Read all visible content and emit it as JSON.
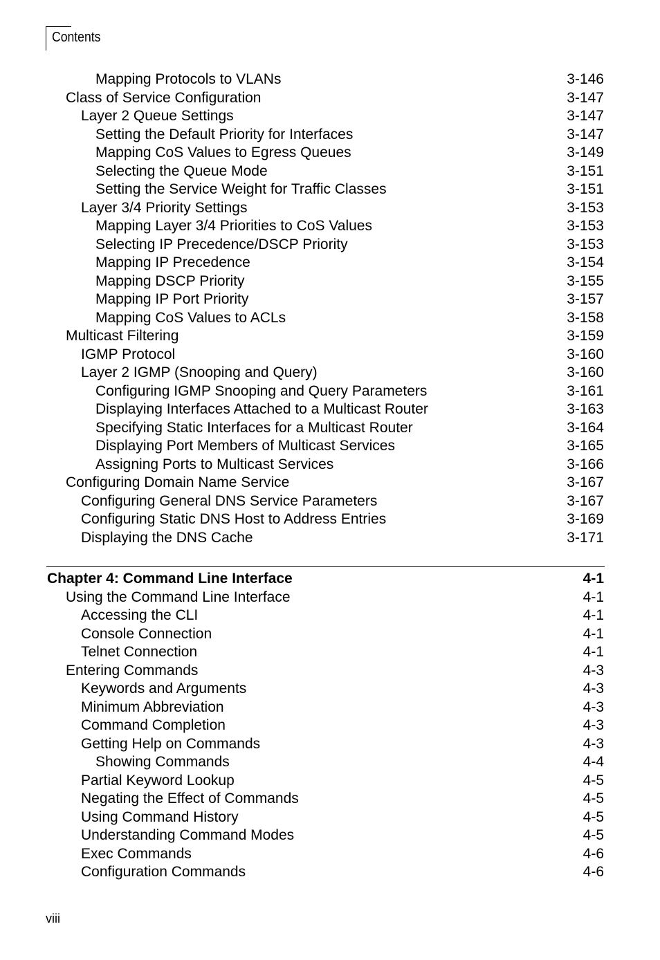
{
  "header": {
    "title": "Contents"
  },
  "footer": {
    "page_number": "viii"
  },
  "entries": [
    {
      "level": 3,
      "title": "Mapping Protocols to VLANs",
      "page": "3-146"
    },
    {
      "level": 1,
      "title": "Class of Service Configuration",
      "page": "3-147"
    },
    {
      "level": 2,
      "title": "Layer 2 Queue Settings",
      "page": "3-147"
    },
    {
      "level": 3,
      "title": "Setting the Default Priority for Interfaces",
      "page": "3-147"
    },
    {
      "level": 3,
      "title": "Mapping CoS Values to Egress Queues",
      "page": "3-149"
    },
    {
      "level": 3,
      "title": "Selecting the Queue Mode",
      "page": "3-151"
    },
    {
      "level": 3,
      "title": "Setting the Service Weight for Traffic Classes",
      "page": "3-151"
    },
    {
      "level": 2,
      "title": "Layer 3/4 Priority Settings",
      "page": "3-153"
    },
    {
      "level": 3,
      "title": "Mapping Layer 3/4 Priorities to CoS Values",
      "page": "3-153"
    },
    {
      "level": 3,
      "title": "Selecting IP Precedence/DSCP Priority",
      "page": "3-153"
    },
    {
      "level": 3,
      "title": "Mapping IP Precedence",
      "page": "3-154"
    },
    {
      "level": 3,
      "title": "Mapping DSCP Priority",
      "page": "3-155"
    },
    {
      "level": 3,
      "title": "Mapping IP Port Priority",
      "page": "3-157"
    },
    {
      "level": 3,
      "title": "Mapping CoS Values to ACLs",
      "page": "3-158"
    },
    {
      "level": 1,
      "title": "Multicast Filtering",
      "page": "3-159"
    },
    {
      "level": 2,
      "title": "IGMP Protocol",
      "page": "3-160"
    },
    {
      "level": 2,
      "title": "Layer 2 IGMP (Snooping and Query)",
      "page": "3-160"
    },
    {
      "level": 3,
      "title": "Configuring IGMP Snooping and Query Parameters",
      "page": "3-161"
    },
    {
      "level": 3,
      "title": "Displaying Interfaces Attached to a Multicast Router",
      "page": "3-163"
    },
    {
      "level": 3,
      "title": "Specifying Static Interfaces for a Multicast Router",
      "page": "3-164"
    },
    {
      "level": 3,
      "title": "Displaying Port Members of Multicast Services",
      "page": "3-165"
    },
    {
      "level": 3,
      "title": "Assigning Ports to Multicast Services",
      "page": "3-166"
    },
    {
      "level": 1,
      "title": "Configuring Domain Name Service",
      "page": "3-167"
    },
    {
      "level": 2,
      "title": "Configuring General DNS Service Parameters",
      "page": "3-167"
    },
    {
      "level": 2,
      "title": "Configuring Static DNS Host to Address Entries",
      "page": "3-169"
    },
    {
      "level": 2,
      "title": "Displaying the DNS Cache",
      "page": "3-171"
    }
  ],
  "chapter": {
    "title": "Chapter 4: Command Line Interface",
    "page": "4-1"
  },
  "chapter_entries": [
    {
      "level": 1,
      "title": "Using the Command Line Interface",
      "page": "4-1"
    },
    {
      "level": 2,
      "title": "Accessing the CLI",
      "page": "4-1"
    },
    {
      "level": 2,
      "title": "Console Connection",
      "page": "4-1"
    },
    {
      "level": 2,
      "title": "Telnet Connection",
      "page": "4-1"
    },
    {
      "level": 1,
      "title": "Entering Commands",
      "page": "4-3"
    },
    {
      "level": 2,
      "title": "Keywords and Arguments",
      "page": "4-3"
    },
    {
      "level": 2,
      "title": "Minimum Abbreviation",
      "page": "4-3"
    },
    {
      "level": 2,
      "title": "Command Completion",
      "page": "4-3"
    },
    {
      "level": 2,
      "title": "Getting Help on Commands",
      "page": "4-3"
    },
    {
      "level": 3,
      "title": "Showing Commands",
      "page": "4-4"
    },
    {
      "level": 2,
      "title": "Partial Keyword Lookup",
      "page": "4-5"
    },
    {
      "level": 2,
      "title": "Negating the Effect of Commands",
      "page": "4-5"
    },
    {
      "level": 2,
      "title": "Using Command History",
      "page": "4-5"
    },
    {
      "level": 2,
      "title": "Understanding Command Modes",
      "page": "4-5"
    },
    {
      "level": 2,
      "title": "Exec Commands",
      "page": "4-6"
    },
    {
      "level": 2,
      "title": "Configuration Commands",
      "page": "4-6"
    }
  ]
}
